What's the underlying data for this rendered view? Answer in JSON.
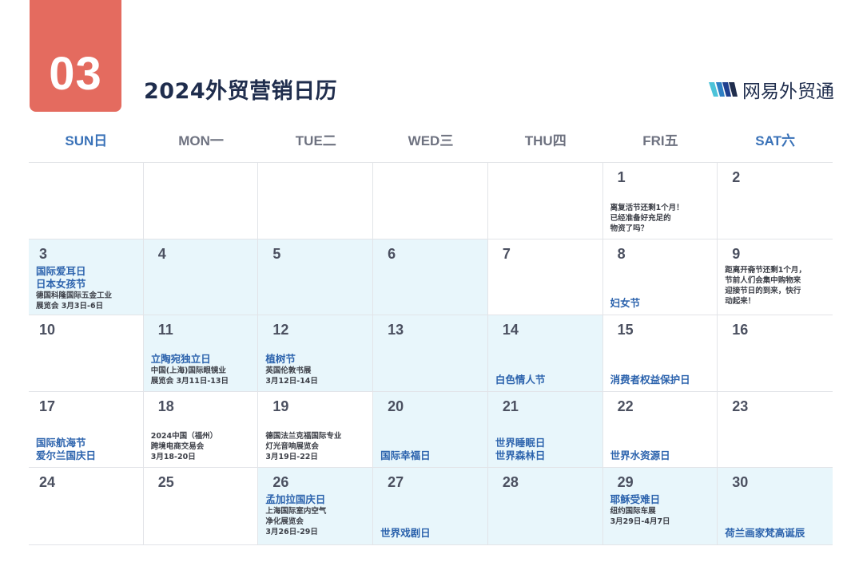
{
  "header": {
    "month": "03",
    "title": "2024外贸营销日历",
    "brand_name": "网易外贸通",
    "brand_icon": "wm-logo-icon",
    "badge_color": "#e46b5f",
    "title_color": "#1f2d4d",
    "event_color": "#2c63ad",
    "highlight_color": "#e8f6fb"
  },
  "weekdays": [
    "SUN日",
    "MON一",
    "TUE二",
    "WED三",
    "THU四",
    "FRI五",
    "SAT六"
  ],
  "days": {
    "d1": "1",
    "d2": "2",
    "d3": "3",
    "d4": "4",
    "d5": "5",
    "d6": "6",
    "d7": "7",
    "d8": "8",
    "d9": "9",
    "d10": "10",
    "d11": "11",
    "d12": "12",
    "d13": "13",
    "d14": "14",
    "d15": "15",
    "d16": "16",
    "d17": "17",
    "d18": "18",
    "d19": "19",
    "d20": "20",
    "d21": "21",
    "d22": "22",
    "d23": "23",
    "d24": "24",
    "d25": "25",
    "d26": "26",
    "d27": "27",
    "d28": "28",
    "d29": "29",
    "d30": "30"
  },
  "events": {
    "d1_note": "离复活节还剩1个月！\n已经准备好充足的\n物资了吗？",
    "d3_evt1": "国际爱耳日",
    "d3_evt2": "日本女孩节",
    "d3_note": "德国科隆国际五金工业\n展览会 3月3日-6日",
    "d8_evt": "妇女节",
    "d9_note": "距离开斋节还剩1个月，\n节前人们会集中购物来\n迎接节日的到来，快行\n动起来！",
    "d11_evt": "立陶宛独立日",
    "d11_note": "中国(上海)国际眼镜业\n展览会 3月11日-13日",
    "d12_evt": "植树节",
    "d12_note": "英国伦敦书展\n3月12日-14日",
    "d14_evt": "白色情人节",
    "d15_evt": "消费者权益保护日",
    "d17_evt1": "国际航海节",
    "d17_evt2": "爱尔兰国庆日",
    "d18_note": "2024中国（福州）\n跨境电商交易会\n3月18-20日",
    "d19_note": "德国法兰克福国际专业\n灯光音响展览会\n3月19日-22日",
    "d20_evt": "国际幸福日",
    "d21_evt1": "世界睡眠日",
    "d21_evt2": "世界森林日",
    "d22_evt": "世界水资源日",
    "d26_evt": "孟加拉国庆日",
    "d26_note": "上海国际室内空气\n净化展览会\n3月26日-29日",
    "d27_evt": "世界戏剧日",
    "d29_evt": "耶稣受难日",
    "d29_note": "纽约国际车展\n3月29日-4月7日",
    "d30_evt": "荷兰画家梵高诞辰"
  }
}
